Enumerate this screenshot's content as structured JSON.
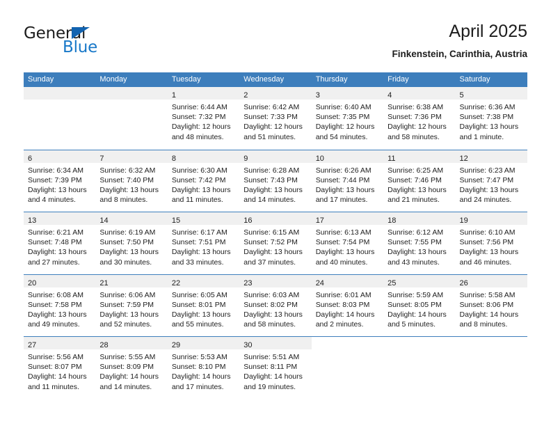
{
  "brand": {
    "name_top": "General",
    "name_bottom": "Blue",
    "triangle_color": "#1263b0",
    "blue_color": "#1878c8"
  },
  "header": {
    "title": "April 2025",
    "subtitle": "Finkenstein, Carinthia, Austria"
  },
  "theme": {
    "header_bg": "#3d7ebc",
    "day_band_bg": "#f0f0f0",
    "row_divider": "#3d7ebc",
    "text": "#202020"
  },
  "weekdays": [
    {
      "label": "Sunday"
    },
    {
      "label": "Monday"
    },
    {
      "label": "Tuesday"
    },
    {
      "label": "Wednesday"
    },
    {
      "label": "Thursday"
    },
    {
      "label": "Friday"
    },
    {
      "label": "Saturday"
    }
  ],
  "weeks": [
    {
      "days": [
        {
          "num": "",
          "sunrise": "",
          "sunset": "",
          "daylight_1": "",
          "daylight_2": "",
          "empty": true
        },
        {
          "num": "",
          "sunrise": "",
          "sunset": "",
          "daylight_1": "",
          "daylight_2": "",
          "empty": true
        },
        {
          "num": "1",
          "sunrise": "Sunrise: 6:44 AM",
          "sunset": "Sunset: 7:32 PM",
          "daylight_1": "Daylight: 12 hours",
          "daylight_2": "and 48 minutes."
        },
        {
          "num": "2",
          "sunrise": "Sunrise: 6:42 AM",
          "sunset": "Sunset: 7:33 PM",
          "daylight_1": "Daylight: 12 hours",
          "daylight_2": "and 51 minutes."
        },
        {
          "num": "3",
          "sunrise": "Sunrise: 6:40 AM",
          "sunset": "Sunset: 7:35 PM",
          "daylight_1": "Daylight: 12 hours",
          "daylight_2": "and 54 minutes."
        },
        {
          "num": "4",
          "sunrise": "Sunrise: 6:38 AM",
          "sunset": "Sunset: 7:36 PM",
          "daylight_1": "Daylight: 12 hours",
          "daylight_2": "and 58 minutes."
        },
        {
          "num": "5",
          "sunrise": "Sunrise: 6:36 AM",
          "sunset": "Sunset: 7:38 PM",
          "daylight_1": "Daylight: 13 hours",
          "daylight_2": "and 1 minute."
        }
      ]
    },
    {
      "days": [
        {
          "num": "6",
          "sunrise": "Sunrise: 6:34 AM",
          "sunset": "Sunset: 7:39 PM",
          "daylight_1": "Daylight: 13 hours",
          "daylight_2": "and 4 minutes."
        },
        {
          "num": "7",
          "sunrise": "Sunrise: 6:32 AM",
          "sunset": "Sunset: 7:40 PM",
          "daylight_1": "Daylight: 13 hours",
          "daylight_2": "and 8 minutes."
        },
        {
          "num": "8",
          "sunrise": "Sunrise: 6:30 AM",
          "sunset": "Sunset: 7:42 PM",
          "daylight_1": "Daylight: 13 hours",
          "daylight_2": "and 11 minutes."
        },
        {
          "num": "9",
          "sunrise": "Sunrise: 6:28 AM",
          "sunset": "Sunset: 7:43 PM",
          "daylight_1": "Daylight: 13 hours",
          "daylight_2": "and 14 minutes."
        },
        {
          "num": "10",
          "sunrise": "Sunrise: 6:26 AM",
          "sunset": "Sunset: 7:44 PM",
          "daylight_1": "Daylight: 13 hours",
          "daylight_2": "and 17 minutes."
        },
        {
          "num": "11",
          "sunrise": "Sunrise: 6:25 AM",
          "sunset": "Sunset: 7:46 PM",
          "daylight_1": "Daylight: 13 hours",
          "daylight_2": "and 21 minutes."
        },
        {
          "num": "12",
          "sunrise": "Sunrise: 6:23 AM",
          "sunset": "Sunset: 7:47 PM",
          "daylight_1": "Daylight: 13 hours",
          "daylight_2": "and 24 minutes."
        }
      ]
    },
    {
      "days": [
        {
          "num": "13",
          "sunrise": "Sunrise: 6:21 AM",
          "sunset": "Sunset: 7:48 PM",
          "daylight_1": "Daylight: 13 hours",
          "daylight_2": "and 27 minutes."
        },
        {
          "num": "14",
          "sunrise": "Sunrise: 6:19 AM",
          "sunset": "Sunset: 7:50 PM",
          "daylight_1": "Daylight: 13 hours",
          "daylight_2": "and 30 minutes."
        },
        {
          "num": "15",
          "sunrise": "Sunrise: 6:17 AM",
          "sunset": "Sunset: 7:51 PM",
          "daylight_1": "Daylight: 13 hours",
          "daylight_2": "and 33 minutes."
        },
        {
          "num": "16",
          "sunrise": "Sunrise: 6:15 AM",
          "sunset": "Sunset: 7:52 PM",
          "daylight_1": "Daylight: 13 hours",
          "daylight_2": "and 37 minutes."
        },
        {
          "num": "17",
          "sunrise": "Sunrise: 6:13 AM",
          "sunset": "Sunset: 7:54 PM",
          "daylight_1": "Daylight: 13 hours",
          "daylight_2": "and 40 minutes."
        },
        {
          "num": "18",
          "sunrise": "Sunrise: 6:12 AM",
          "sunset": "Sunset: 7:55 PM",
          "daylight_1": "Daylight: 13 hours",
          "daylight_2": "and 43 minutes."
        },
        {
          "num": "19",
          "sunrise": "Sunrise: 6:10 AM",
          "sunset": "Sunset: 7:56 PM",
          "daylight_1": "Daylight: 13 hours",
          "daylight_2": "and 46 minutes."
        }
      ]
    },
    {
      "days": [
        {
          "num": "20",
          "sunrise": "Sunrise: 6:08 AM",
          "sunset": "Sunset: 7:58 PM",
          "daylight_1": "Daylight: 13 hours",
          "daylight_2": "and 49 minutes."
        },
        {
          "num": "21",
          "sunrise": "Sunrise: 6:06 AM",
          "sunset": "Sunset: 7:59 PM",
          "daylight_1": "Daylight: 13 hours",
          "daylight_2": "and 52 minutes."
        },
        {
          "num": "22",
          "sunrise": "Sunrise: 6:05 AM",
          "sunset": "Sunset: 8:01 PM",
          "daylight_1": "Daylight: 13 hours",
          "daylight_2": "and 55 minutes."
        },
        {
          "num": "23",
          "sunrise": "Sunrise: 6:03 AM",
          "sunset": "Sunset: 8:02 PM",
          "daylight_1": "Daylight: 13 hours",
          "daylight_2": "and 58 minutes."
        },
        {
          "num": "24",
          "sunrise": "Sunrise: 6:01 AM",
          "sunset": "Sunset: 8:03 PM",
          "daylight_1": "Daylight: 14 hours",
          "daylight_2": "and 2 minutes."
        },
        {
          "num": "25",
          "sunrise": "Sunrise: 5:59 AM",
          "sunset": "Sunset: 8:05 PM",
          "daylight_1": "Daylight: 14 hours",
          "daylight_2": "and 5 minutes."
        },
        {
          "num": "26",
          "sunrise": "Sunrise: 5:58 AM",
          "sunset": "Sunset: 8:06 PM",
          "daylight_1": "Daylight: 14 hours",
          "daylight_2": "and 8 minutes."
        }
      ]
    },
    {
      "days": [
        {
          "num": "27",
          "sunrise": "Sunrise: 5:56 AM",
          "sunset": "Sunset: 8:07 PM",
          "daylight_1": "Daylight: 14 hours",
          "daylight_2": "and 11 minutes."
        },
        {
          "num": "28",
          "sunrise": "Sunrise: 5:55 AM",
          "sunset": "Sunset: 8:09 PM",
          "daylight_1": "Daylight: 14 hours",
          "daylight_2": "and 14 minutes."
        },
        {
          "num": "29",
          "sunrise": "Sunrise: 5:53 AM",
          "sunset": "Sunset: 8:10 PM",
          "daylight_1": "Daylight: 14 hours",
          "daylight_2": "and 17 minutes."
        },
        {
          "num": "30",
          "sunrise": "Sunrise: 5:51 AM",
          "sunset": "Sunset: 8:11 PM",
          "daylight_1": "Daylight: 14 hours",
          "daylight_2": "and 19 minutes."
        },
        {
          "num": "",
          "sunrise": "",
          "sunset": "",
          "daylight_1": "",
          "daylight_2": "",
          "empty": true,
          "blank": true
        },
        {
          "num": "",
          "sunrise": "",
          "sunset": "",
          "daylight_1": "",
          "daylight_2": "",
          "empty": true,
          "blank": true
        },
        {
          "num": "",
          "sunrise": "",
          "sunset": "",
          "daylight_1": "",
          "daylight_2": "",
          "empty": true,
          "blank": true
        }
      ]
    }
  ]
}
